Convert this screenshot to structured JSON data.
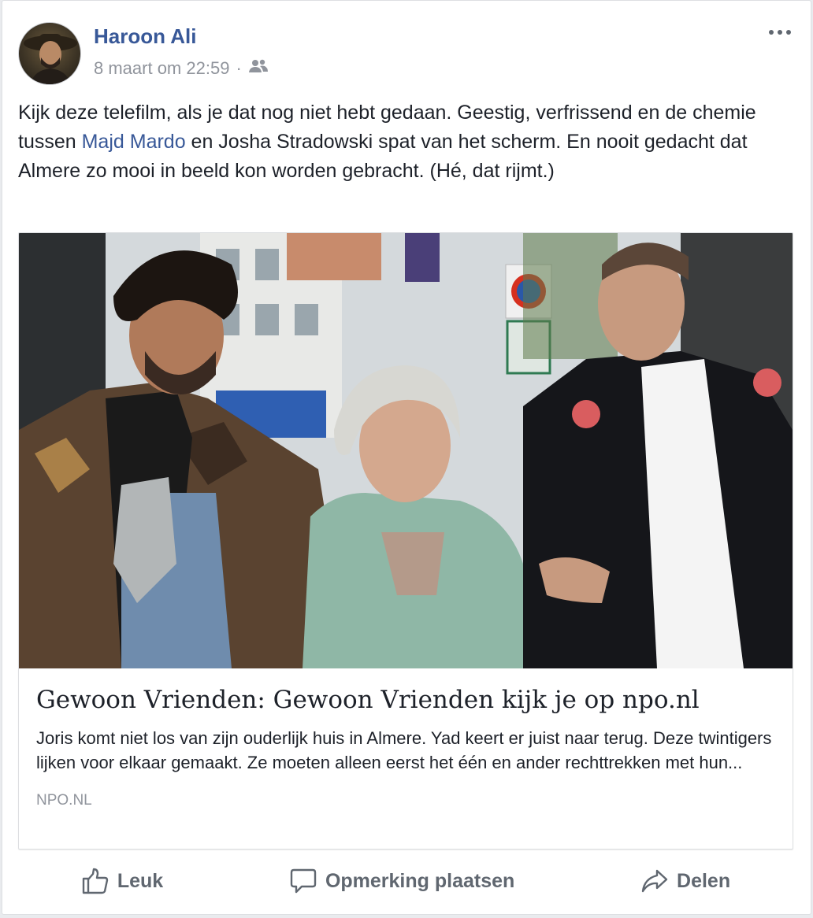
{
  "post": {
    "author": "Haroon Ali",
    "date": "8 maart om 22:59",
    "separator": "·",
    "audience_icon": "friends-icon",
    "more_icon": "more-options-icon",
    "text_before": "Kijk deze telefilm, als je dat nog niet hebt gedaan. Geestig, verfrissend en de chemie tussen ",
    "mention": "Majd Mardo",
    "text_after": " en Josha Stradowski spat van het scherm. En nooit gedacht dat Almere zo mooi in beeld kon worden gebracht. (Hé, dat rijmt.)"
  },
  "link": {
    "title": "Gewoon Vrienden: Gewoon Vrienden kijk je op npo.nl",
    "description": "Joris komt niet los van zijn ouderlijk huis in Almere. Yad keert er juist naar terug. Deze twintigers lijken voor elkaar gemaakt. Ze moeten alleen eerst het één en ander rechttrekken met hun...",
    "domain": "NPO.NL"
  },
  "actions": {
    "like": "Leuk",
    "comment": "Opmerking plaatsen",
    "share": "Delen"
  },
  "colors": {
    "link_blue": "#385898",
    "meta_gray": "#90949c",
    "action_gray": "#606770",
    "text": "#1d2129"
  }
}
